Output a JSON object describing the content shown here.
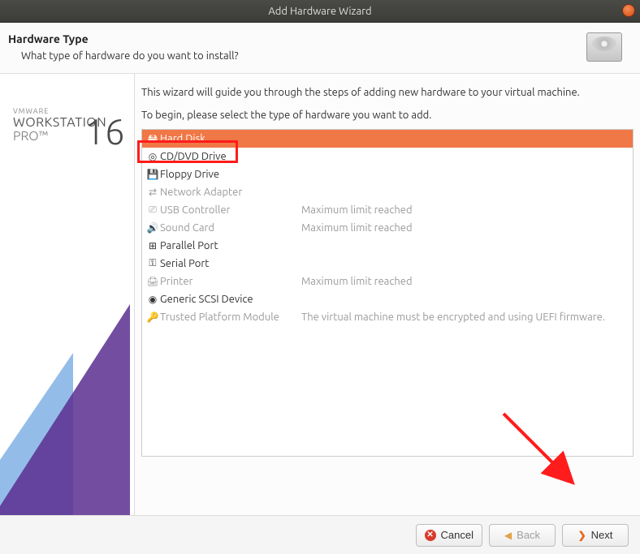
{
  "window": {
    "title": "Add Hardware Wizard"
  },
  "header": {
    "title": "Hardware Type",
    "subtitle": "What type of hardware do you want to install?"
  },
  "sidebar_logo": {
    "line1": "VMWARE",
    "line2": "WORKSTATION",
    "line3": "PRO™",
    "version": "16"
  },
  "main": {
    "intro1": "This wizard will guide you through the steps of adding new hardware to your virtual machine.",
    "intro2": "To begin, please select the type of hardware you want to add.",
    "hardware": [
      {
        "id": "hard-disk",
        "label": "Hard Disk",
        "status": "",
        "icon": "🖴",
        "selected": true,
        "disabled": false
      },
      {
        "id": "cd-dvd",
        "label": "CD/DVD Drive",
        "status": "",
        "icon": "◎",
        "selected": false,
        "disabled": false
      },
      {
        "id": "floppy",
        "label": "Floppy Drive",
        "status": "",
        "icon": "💾",
        "selected": false,
        "disabled": false
      },
      {
        "id": "net-adapter",
        "label": "Network Adapter",
        "status": "",
        "icon": "⇄",
        "selected": false,
        "disabled": true
      },
      {
        "id": "usb",
        "label": "USB Controller",
        "status": "Maximum limit reached",
        "icon": "⎚",
        "selected": false,
        "disabled": true
      },
      {
        "id": "sound",
        "label": "Sound Card",
        "status": "Maximum limit reached",
        "icon": "🔊",
        "selected": false,
        "disabled": true
      },
      {
        "id": "parallel",
        "label": "Parallel Port",
        "status": "",
        "icon": "⊞",
        "selected": false,
        "disabled": false
      },
      {
        "id": "serial",
        "label": "Serial Port",
        "status": "",
        "icon": "⚿",
        "selected": false,
        "disabled": false
      },
      {
        "id": "printer",
        "label": "Printer",
        "status": "Maximum limit reached",
        "icon": "🖨",
        "selected": false,
        "disabled": true
      },
      {
        "id": "scsi",
        "label": "Generic SCSI Device",
        "status": "",
        "icon": "◉",
        "selected": false,
        "disabled": false
      },
      {
        "id": "tpm",
        "label": "Trusted Platform Module",
        "status": "The virtual machine must be encrypted and using UEFI firmware.",
        "icon": "🔑",
        "selected": false,
        "disabled": true
      }
    ]
  },
  "footer": {
    "cancel": "Cancel",
    "back": "Back",
    "next": "Next"
  },
  "annotations": {
    "highlight_item": "hard-disk",
    "arrow_target": "next-button"
  }
}
